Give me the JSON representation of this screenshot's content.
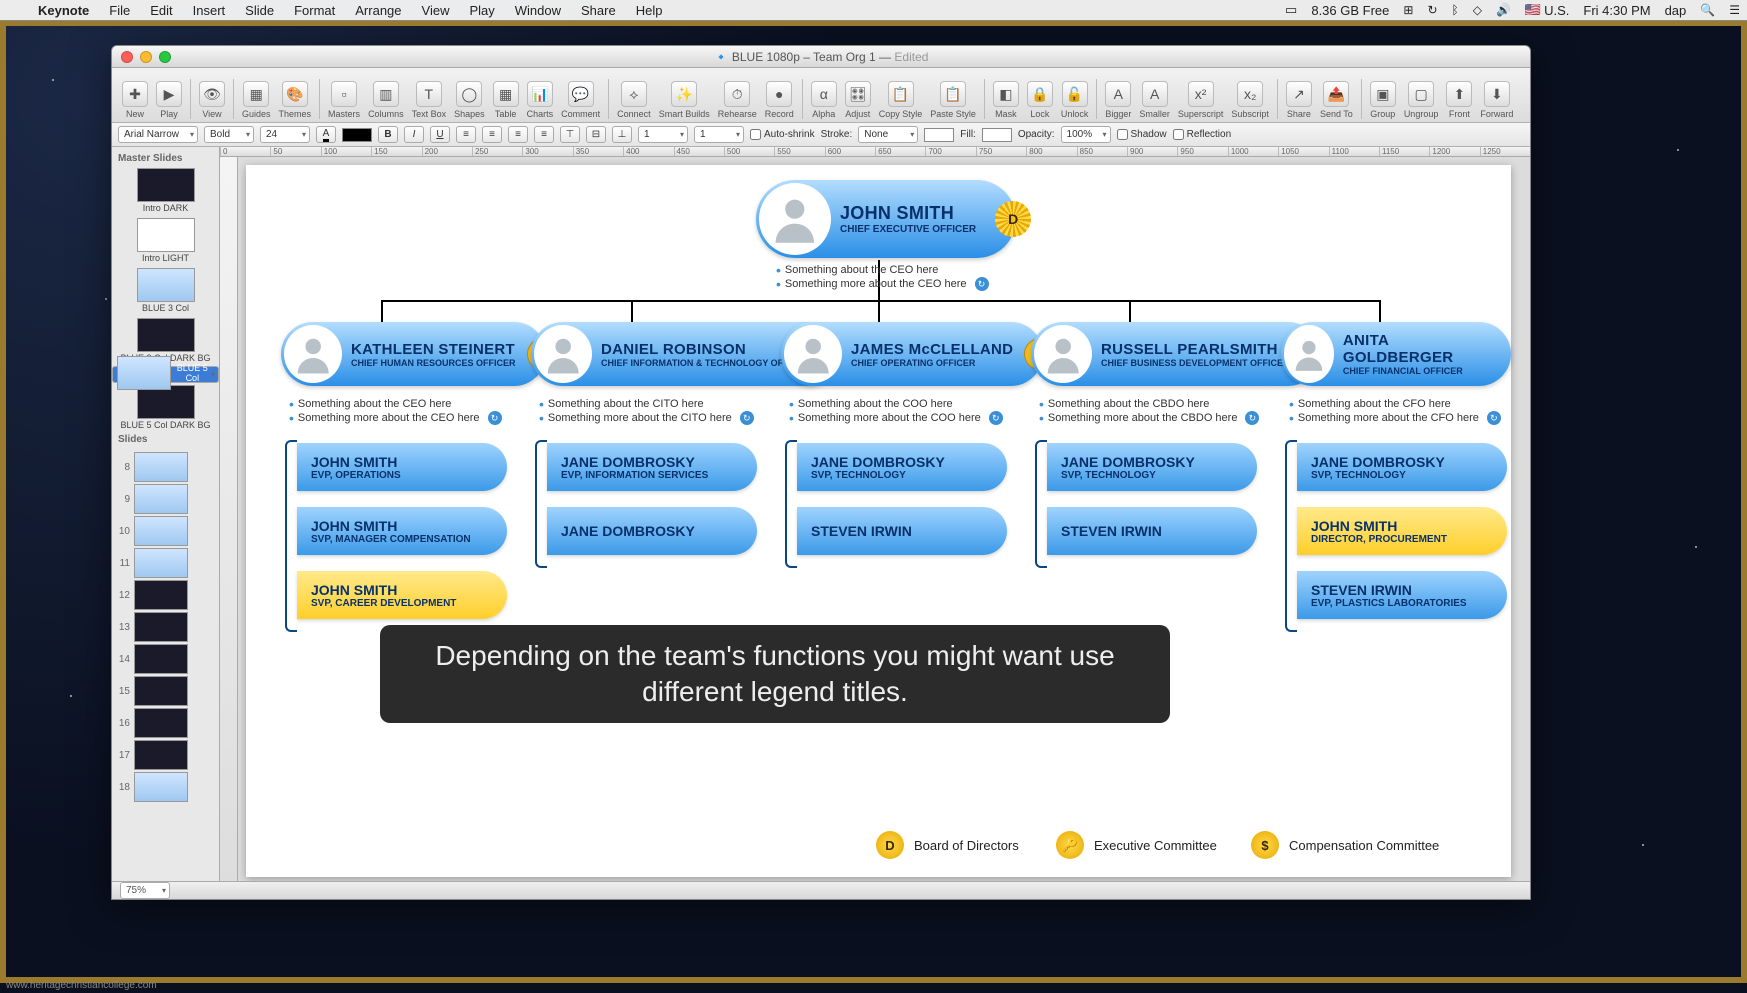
{
  "menubar": {
    "app": "Keynote",
    "items": [
      "File",
      "Edit",
      "Insert",
      "Slide",
      "Format",
      "Arrange",
      "View",
      "Play",
      "Window",
      "Share",
      "Help"
    ],
    "right": {
      "disk": "8.36 GB Free",
      "locale": "U.S.",
      "clock": "Fri 4:30 PM",
      "user": "dap"
    }
  },
  "window": {
    "title_doc": "BLUE 1080p – Team Org 1",
    "title_state": "Edited"
  },
  "toolbar": {
    "buttons": [
      "New",
      "Play",
      "View",
      "Guides",
      "Themes",
      "Masters",
      "Columns",
      "Text Box",
      "Shapes",
      "Table",
      "Charts",
      "Comment",
      "Connect",
      "Smart Builds",
      "Rehearse",
      "Record",
      "Alpha",
      "Adjust",
      "Copy Style",
      "Paste Style",
      "Mask",
      "Lock",
      "Unlock",
      "Bigger",
      "Smaller",
      "Superscript",
      "Subscript",
      "Share",
      "Send To",
      "Group",
      "Ungroup",
      "Front",
      "Forward"
    ]
  },
  "fmt": {
    "font": "Arial Narrow",
    "weight": "Bold",
    "size": "24",
    "stroke_lbl": "Stroke:",
    "stroke_val": "None",
    "fill_lbl": "Fill:",
    "opacity_lbl": "Opacity:",
    "opacity_val": "100%",
    "autoshrink": "Auto-shrink",
    "shadow": "Shadow",
    "reflection": "Reflection"
  },
  "sidebar": {
    "master_hdr": "Master Slides",
    "masters": [
      "Intro DARK",
      "Intro LIGHT",
      "BLUE 3 Col",
      "BLUE 3 Col DARK BG",
      "BLUE 5 Col",
      "BLUE 5 Col DARK BG"
    ],
    "slides_hdr": "Slides",
    "nums": [
      "8",
      "9",
      "10",
      "11",
      "12",
      "13",
      "14",
      "15",
      "16",
      "17",
      "18"
    ]
  },
  "statusbar": {
    "zoom": "75%"
  },
  "org": {
    "ceo": {
      "name": "JOHN SMITH",
      "title": "CHIEF EXECUTIVE OFFICER",
      "badge": "D",
      "b1": "Something about the CEO here",
      "b2": "Something more about the CEO here"
    },
    "cols": [
      {
        "name": "KATHLEEN STEINERT",
        "title": "CHIEF HUMAN RESOURCES OFFICER",
        "badge": "D",
        "b1": "Something about the CEO here",
        "b2": "Something more about the CEO here",
        "subs": [
          {
            "n": "JOHN SMITH",
            "t": "EVP, OPERATIONS"
          },
          {
            "n": "JOHN SMITH",
            "t": "SVP, MANAGER COMPENSATION"
          },
          {
            "n": "JOHN SMITH",
            "t": "SVP, CAREER DEVELOPMENT",
            "y": true
          }
        ]
      },
      {
        "name": "DANIEL ROBINSON",
        "title": "CHIEF INFORMATION & TECHNOLOGY OFFICER",
        "badge": "$",
        "b1": "Something about the CITO here",
        "b2": "Something more about the CITO here",
        "subs": [
          {
            "n": "JANE DOMBROSKY",
            "t": "EVP, INFORMATION SERVICES"
          },
          {
            "n": "JANE DOMBROSKY",
            "t": ""
          }
        ]
      },
      {
        "name": "JAMES McCLELLAND",
        "title": "CHIEF OPERATING OFFICER",
        "badge": "🔑",
        "b1": "Something about the COO here",
        "b2": "Something more about the COO here",
        "subs": [
          {
            "n": "JANE DOMBROSKY",
            "t": "SVP, TECHNOLOGY"
          },
          {
            "n": "STEVEN IRWIN",
            "t": ""
          }
        ]
      },
      {
        "name": "RUSSELL PEARLSMITH",
        "title": "CHIEF BUSINESS DEVELOPMENT OFFICER",
        "badge": "$",
        "b1": "Something about the CBDO here",
        "b2": "Something more about the CBDO here",
        "subs": [
          {
            "n": "JANE DOMBROSKY",
            "t": "SVP, TECHNOLOGY"
          },
          {
            "n": "STEVEN IRWIN",
            "t": ""
          }
        ]
      },
      {
        "name": "ANITA GOLDBERGER",
        "title": "CHIEF FINANCIAL OFFICER",
        "badge": "",
        "b1": "Something about the CFO here",
        "b2": "Something more about the CFO here",
        "subs": [
          {
            "n": "JANE DOMBROSKY",
            "t": "SVP, TECHNOLOGY"
          },
          {
            "n": "JOHN SMITH",
            "t": "DIRECTOR, PROCUREMENT",
            "y": true
          },
          {
            "n": "STEVEN IRWIN",
            "t": "EVP, PLASTICS LABORATORIES"
          }
        ]
      }
    ],
    "legend": [
      {
        "b": "D",
        "t": "Board of Directors"
      },
      {
        "b": "🔑",
        "t": "Executive Committee"
      },
      {
        "b": "$",
        "t": "Compensation Committee"
      }
    ]
  },
  "caption": "Depending on the team's functions you might want use different legend titles.",
  "watermark": "www.heritagechristiancollege.com"
}
